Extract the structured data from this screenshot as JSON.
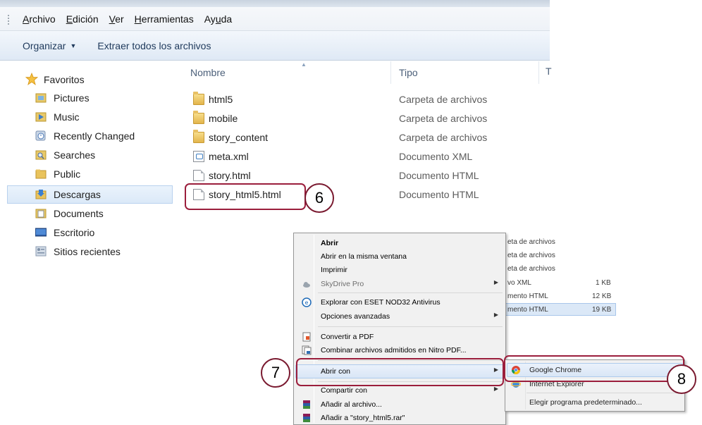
{
  "menubar": {
    "items": [
      {
        "pre": "",
        "u": "A",
        "post": "rchivo"
      },
      {
        "pre": "",
        "u": "E",
        "post": "dición"
      },
      {
        "pre": "",
        "u": "V",
        "post": "er"
      },
      {
        "pre": "",
        "u": "H",
        "post": "erramientas"
      },
      {
        "pre": "Ay",
        "u": "u",
        "post": "da"
      }
    ]
  },
  "toolbar": {
    "organize_label": "Organizar",
    "extract_label": "Extraer todos los archivos"
  },
  "navpane": {
    "favorites_label": "Favoritos",
    "items": [
      {
        "label": "Pictures",
        "icon": "pictures-icon"
      },
      {
        "label": "Music",
        "icon": "music-icon"
      },
      {
        "label": "Recently Changed",
        "icon": "recent-icon"
      },
      {
        "label": "Searches",
        "icon": "search-folder-icon"
      },
      {
        "label": "Public",
        "icon": "folder-icon"
      },
      {
        "label": "Descargas",
        "icon": "downloads-icon",
        "selected": true
      },
      {
        "label": "Documents",
        "icon": "documents-icon"
      },
      {
        "label": "Escritorio",
        "icon": "desktop-icon"
      },
      {
        "label": "Sitios recientes",
        "icon": "recent-places-icon"
      }
    ]
  },
  "filelist": {
    "columns": {
      "name": "Nombre",
      "type": "Tipo"
    },
    "rows": [
      {
        "name": "html5",
        "type": "Carpeta de archivos",
        "icon": "folder-icon"
      },
      {
        "name": "mobile",
        "type": "Carpeta de archivos",
        "icon": "folder-icon"
      },
      {
        "name": "story_content",
        "type": "Carpeta de archivos",
        "icon": "folder-icon"
      },
      {
        "name": "meta.xml",
        "type": "Documento XML",
        "icon": "xml-file-icon"
      },
      {
        "name": "story.html",
        "type": "Documento HTML",
        "icon": "html-file-icon"
      },
      {
        "name": "story_html5.html",
        "type": "Documento HTML",
        "icon": "html-file-icon"
      }
    ]
  },
  "callouts": {
    "step6": "6",
    "step7": "7",
    "step8": "8"
  },
  "background_rows": [
    {
      "type": "eta de archivos",
      "size": ""
    },
    {
      "type": "eta de archivos",
      "size": ""
    },
    {
      "type": "eta de archivos",
      "size": ""
    },
    {
      "type": "vo XML",
      "size": "1 KB"
    },
    {
      "type": "mento HTML",
      "size": "12 KB"
    },
    {
      "type": "mento HTML",
      "size": "19 KB"
    }
  ],
  "context_menu": {
    "items": [
      {
        "label": "Abrir",
        "bold": true
      },
      {
        "label": "Abrir en la misma ventana"
      },
      {
        "label": "Imprimir"
      },
      {
        "label": "SkyDrive Pro",
        "disabled": true,
        "submenu": true
      },
      {
        "label": "Explorar con ESET NOD32 Antivirus"
      },
      {
        "label": "Opciones avanzadas",
        "submenu": true
      },
      {
        "label": "Convertir a PDF"
      },
      {
        "label": "Combinar archivos admitidos en Nitro PDF..."
      },
      {
        "label": "Abrir con",
        "submenu": true,
        "highlighted": true
      },
      {
        "label": "Compartir con",
        "submenu": true
      },
      {
        "label": "Añadir al archivo..."
      },
      {
        "label": "Añadir a \"story_html5.rar\""
      }
    ]
  },
  "open_with_submenu": {
    "items": [
      {
        "label": "Google Chrome",
        "highlighted": true
      },
      {
        "label": "Internet Explorer"
      },
      {
        "label": "Elegir programa predeterminado..."
      }
    ]
  },
  "colors": {
    "annotation": "#9b1e3c",
    "selection": "#dbe9f8"
  }
}
